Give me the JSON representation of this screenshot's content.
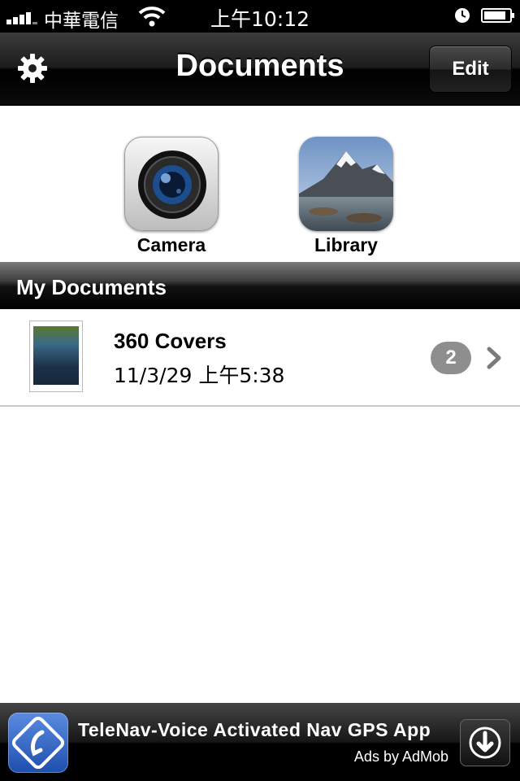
{
  "status_bar": {
    "carrier": "中華電信",
    "time": "上午10:12"
  },
  "nav": {
    "title": "Documents",
    "edit_label": "Edit",
    "settings_icon": "gear-icon"
  },
  "sources": [
    {
      "label": "Camera",
      "icon": "camera-icon"
    },
    {
      "label": "Library",
      "icon": "photo-library-icon"
    }
  ],
  "section": {
    "title": "My Documents"
  },
  "documents": [
    {
      "title": "360 Covers",
      "date": "11/3/29 上午5:38",
      "page_count": "2"
    }
  ],
  "ad": {
    "title": "TeleNav-Voice Activated Nav GPS App",
    "subtitle": "Ads by AdMob"
  },
  "colors": {
    "bar_black": "#000000",
    "badge_gray": "#8e8e8e"
  }
}
